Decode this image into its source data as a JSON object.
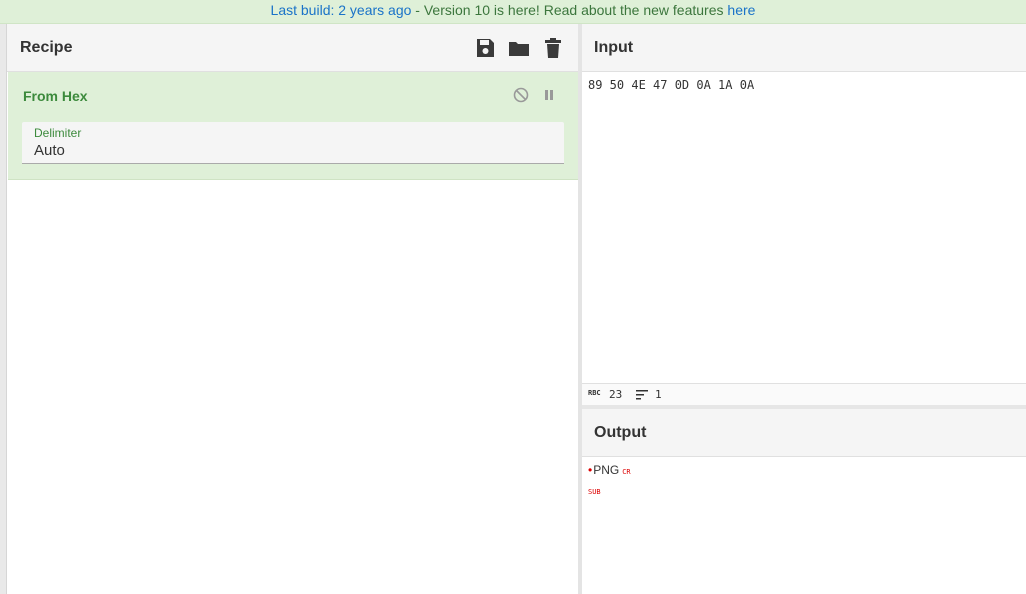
{
  "banner": {
    "link1": "Last build: 2 years ago",
    "text": " - Version 10 is here! Read about the new features ",
    "link2": "here"
  },
  "recipe": {
    "title": "Recipe",
    "icons": [
      "save-icon",
      "folder-icon",
      "trash-icon"
    ],
    "operation": {
      "name": "From Hex",
      "arg_label": "Delimiter",
      "arg_value": "Auto"
    }
  },
  "input": {
    "title": "Input",
    "text": "89 50 4E 47 0D 0A 1A 0A",
    "length": "23",
    "lines": "1"
  },
  "output": {
    "title": "Output",
    "text": "PNG",
    "cr_label": "CR",
    "sub_label": "SUB"
  }
}
